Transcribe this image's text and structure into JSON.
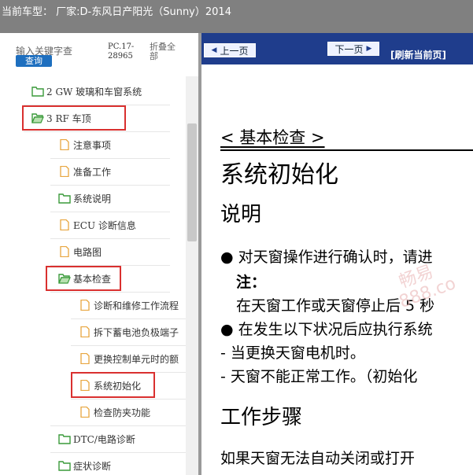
{
  "header": {
    "title": "当前车型： 厂家:D-东风日产阳光（Sunny）2014"
  },
  "sidebar": {
    "search_label": "输入关键字查",
    "query_button": "查询",
    "pc_number": "PC.17-28965",
    "collapse_all": "折叠全部",
    "items": [
      {
        "label": "2 GW 玻璃和车窗系统",
        "icon": "folder-icon"
      },
      {
        "label": "3 RF 车顶",
        "icon": "folder-open-icon"
      },
      {
        "label": "注意事项",
        "icon": "document-icon"
      },
      {
        "label": "准备工作",
        "icon": "document-icon"
      },
      {
        "label": "系统说明",
        "icon": "folder-icon"
      },
      {
        "label": "ECU 诊断信息",
        "icon": "document-icon"
      },
      {
        "label": "电路图",
        "icon": "document-icon"
      },
      {
        "label": "基本检查",
        "icon": "folder-open-icon"
      },
      {
        "label": "诊断和维修工作流程",
        "icon": "document-icon"
      },
      {
        "label": "拆下蓄电池负极端子",
        "icon": "document-icon"
      },
      {
        "label": "更换控制单元时的额",
        "icon": "document-icon"
      },
      {
        "label": "系统初始化",
        "icon": "document-icon"
      },
      {
        "label": "检查防夹功能",
        "icon": "document-icon"
      },
      {
        "label": "DTC/电路诊断",
        "icon": "folder-icon"
      },
      {
        "label": "症状诊断",
        "icon": "folder-icon"
      }
    ]
  },
  "toolbar": {
    "prev_label": "上一页",
    "next_label": "下一页",
    "refresh_label": "[刷新当前页]"
  },
  "document": {
    "section": "< 基本检查 >",
    "title": "系统初始化",
    "heading_desc": "说明",
    "lines": [
      "对天窗操作进行确认时，请进",
      "注：",
      "在天窗工作或天窗停止后 5 秒",
      "在发生以下状况后应执行系统",
      "- 当更换天窗电机时。",
      "- 天窗不能正常工作。（初始化"
    ],
    "heading_steps": "工作步骤",
    "step_line": "如果天窗无法自动关闭或打开"
  },
  "watermark": {
    "text1": "畅易",
    "text2": "888.co"
  },
  "colors": {
    "nav_bar": "#1f3d8c",
    "highlight_box": "#d9302f",
    "folder": "#3a9a3a",
    "document": "#e8a640"
  }
}
